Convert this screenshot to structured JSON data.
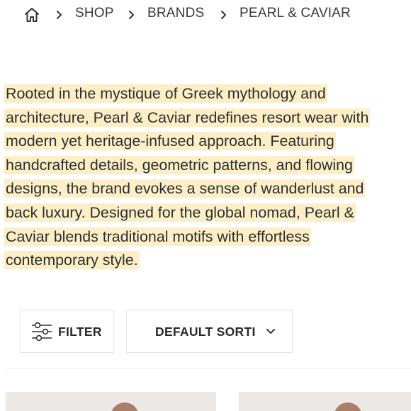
{
  "breadcrumb": {
    "home_icon": "home-icon",
    "separator_icon": "chevron-right-icon",
    "items": [
      "SHOP",
      "BRANDS",
      "PEARL & CAVIAR"
    ]
  },
  "description": {
    "highlight_color": "#fcefc7",
    "lines": [
      "Rooted in the mystique of Greek mythology and",
      "architecture, Pearl & Caviar redefines resort wear with",
      "modern yet heritage-infused approach. Featuring",
      "handcrafted details, geometric patterns, and flowing",
      "designs, the brand evokes a sense of wanderlust and",
      "back luxury. Designed for the global nomad, Pearl &",
      "Caviar blends traditional motifs with effortless",
      "contemporary style."
    ]
  },
  "toolbar": {
    "filter_icon": "sliders-icon",
    "filter_label": "FILTER",
    "sort_label": "DEFAULT SORTI",
    "sort_icon": "chevron-down-icon"
  }
}
